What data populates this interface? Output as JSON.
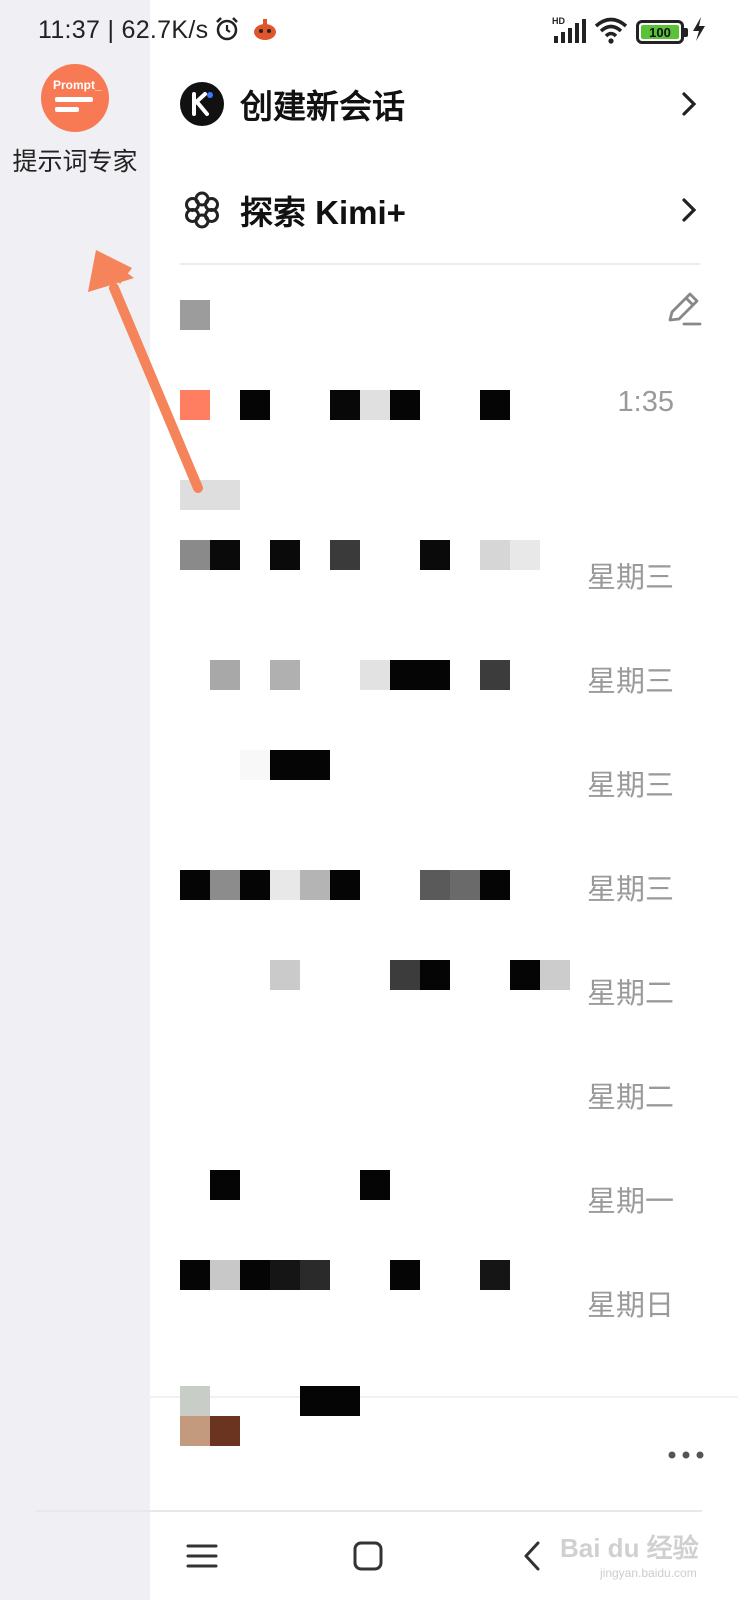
{
  "status_bar": {
    "time": "11:37 | 62.7K/s",
    "battery": "100",
    "network_label": "HD"
  },
  "agent": {
    "avatar_text": "Prompt_",
    "name": "提示词专家"
  },
  "menu": {
    "new_chat": "创建新会话",
    "explore": "探索 Kimi+"
  },
  "chats": [
    {
      "date": "1:35"
    },
    {
      "date": "星期三"
    },
    {
      "date": "星期三"
    },
    {
      "date": "星期三"
    },
    {
      "date": "星期三"
    },
    {
      "date": "星期二"
    },
    {
      "date": "星期二"
    },
    {
      "date": "星期一"
    },
    {
      "date": "星期日"
    }
  ],
  "watermark": {
    "text": "Bai du 经验",
    "sub": "jingyan.baidu.com"
  },
  "icons": {
    "alarm": "alarm-clock-icon",
    "app": "app-notification-icon",
    "signal": "signal-icon",
    "wifi": "wifi-icon",
    "charging": "charging-icon",
    "kimi_logo": "kimi-logo-icon",
    "explore": "flower-icon",
    "edit": "edit-pencil-icon",
    "chevron": "chevron-right-icon",
    "more": "more-dots-icon",
    "nav_menu": "menu-icon",
    "nav_home": "home-square-icon",
    "nav_back": "back-chevron-icon",
    "arrow": "annotation-arrow-icon"
  },
  "colors": {
    "accent": "#f77a55",
    "rail_background": "#efeff4",
    "date_text": "#9a9a9a",
    "arrow": "#f5845a"
  }
}
